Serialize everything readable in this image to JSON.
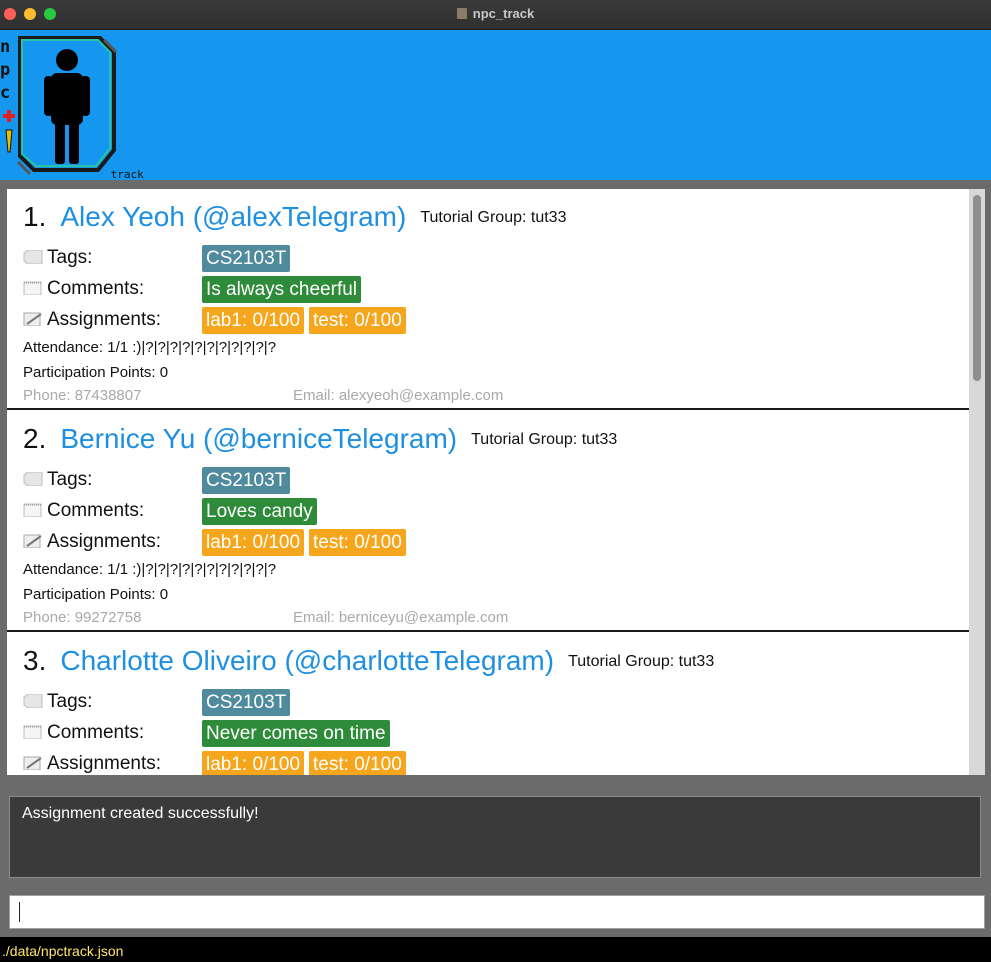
{
  "window": {
    "title": "npc_track"
  },
  "header": {
    "logo_letters": [
      "n",
      "p",
      "c"
    ],
    "logo_suffix": "_track"
  },
  "persons": [
    {
      "index": "1.",
      "name": "Alex Yeoh (@alexTelegram)",
      "tutorial": "Tutorial Group: tut33",
      "tags_label": "Tags:",
      "tags": [
        "CS2103T"
      ],
      "comments_label": "Comments:",
      "comments": [
        "Is always cheerful"
      ],
      "assignments_label": "Assignments:",
      "assignments": [
        "lab1: 0/100",
        "test: 0/100"
      ],
      "attendance": "Attendance: 1/1  :)|?|?|?|?|?|?|?|?|?|?|?",
      "participation": "Participation Points: 0",
      "phone": "Phone: 87438807",
      "email": "Email: alexyeoh@example.com"
    },
    {
      "index": "2.",
      "name": "Bernice Yu (@berniceTelegram)",
      "tutorial": "Tutorial Group: tut33",
      "tags_label": "Tags:",
      "tags": [
        "CS2103T"
      ],
      "comments_label": "Comments:",
      "comments": [
        "Loves candy"
      ],
      "assignments_label": "Assignments:",
      "assignments": [
        "lab1: 0/100",
        "test: 0/100"
      ],
      "attendance": "Attendance: 1/1  :)|?|?|?|?|?|?|?|?|?|?|?",
      "participation": "Participation Points: 0",
      "phone": "Phone: 99272758",
      "email": "Email: berniceyu@example.com"
    },
    {
      "index": "3.",
      "name": "Charlotte Oliveiro (@charlotteTelegram)",
      "tutorial": "Tutorial Group: tut33",
      "tags_label": "Tags:",
      "tags": [
        "CS2103T"
      ],
      "comments_label": "Comments:",
      "comments": [
        "Never comes on time"
      ],
      "assignments_label": "Assignments:",
      "assignments": [
        "lab1: 0/100",
        "test: 0/100"
      ]
    }
  ],
  "result": {
    "message": "Assignment created successfully!"
  },
  "command": {
    "value": ""
  },
  "status": {
    "path": "./data/npctrack.json"
  },
  "colors": {
    "header": "#1597f0",
    "name": "#1e8fe1",
    "tag": "#4f8a9d",
    "comment": "#2e8b3a",
    "assignment": "#f5a61c",
    "status_text": "#ffe66b"
  }
}
